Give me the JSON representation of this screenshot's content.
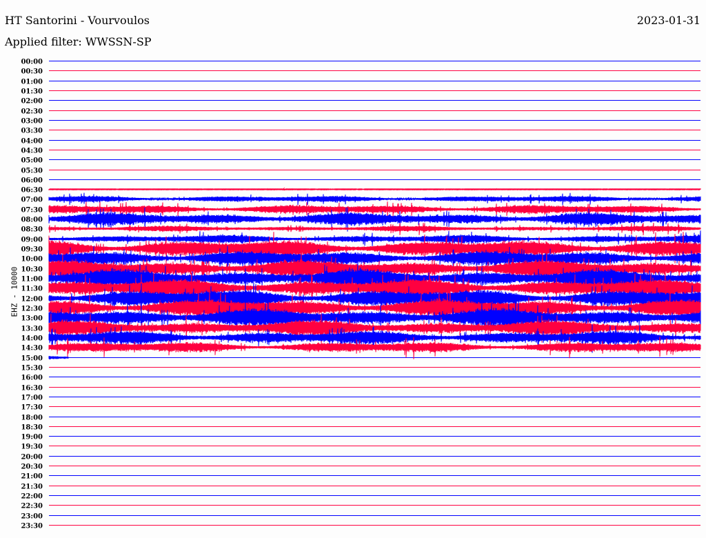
{
  "header": {
    "title": "HT Santorini - Vourvoulos",
    "filter": "Applied filter: WWSSN-SP",
    "date": "2023-01-31"
  },
  "chart_data": {
    "type": "line",
    "title": "HT Santorini - Vourvoulos",
    "subtitle": "Applied filter: WWSSN-SP",
    "ylabel": "EHZ - 10000",
    "xlabel": "",
    "colors": {
      "even": "#0000ff",
      "odd": "#ff0040"
    },
    "rows": [
      {
        "label": "00:00",
        "amplitude": 0
      },
      {
        "label": "00:30",
        "amplitude": 0
      },
      {
        "label": "01:00",
        "amplitude": 0
      },
      {
        "label": "01:30",
        "amplitude": 0
      },
      {
        "label": "02:00",
        "amplitude": 0
      },
      {
        "label": "02:30",
        "amplitude": 0
      },
      {
        "label": "03:00",
        "amplitude": 0
      },
      {
        "label": "03:30",
        "amplitude": 0
      },
      {
        "label": "04:00",
        "amplitude": 0
      },
      {
        "label": "04:30",
        "amplitude": 0
      },
      {
        "label": "05:00",
        "amplitude": 0
      },
      {
        "label": "05:30",
        "amplitude": 0
      },
      {
        "label": "06:00",
        "amplitude": 0
      },
      {
        "label": "06:30",
        "amplitude": 0.05
      },
      {
        "label": "07:00",
        "amplitude": 0.35
      },
      {
        "label": "07:30",
        "amplitude": 0.5
      },
      {
        "label": "08:00",
        "amplitude": 0.7
      },
      {
        "label": "08:30",
        "amplitude": 0.3
      },
      {
        "label": "09:00",
        "amplitude": 0.45
      },
      {
        "label": "09:30",
        "amplitude": 0.95
      },
      {
        "label": "10:00",
        "amplitude": 0.85
      },
      {
        "label": "10:30",
        "amplitude": 0.95
      },
      {
        "label": "11:00",
        "amplitude": 1.0
      },
      {
        "label": "11:30",
        "amplitude": 1.0
      },
      {
        "label": "12:00",
        "amplitude": 1.0
      },
      {
        "label": "12:30",
        "amplitude": 1.0
      },
      {
        "label": "13:00",
        "amplitude": 1.0
      },
      {
        "label": "13:30",
        "amplitude": 0.85
      },
      {
        "label": "14:00",
        "amplitude": 0.75
      },
      {
        "label": "14:30",
        "amplitude": 0.6
      },
      {
        "label": "15:00",
        "amplitude": 0.4,
        "partial": 0.03
      },
      {
        "label": "15:30",
        "amplitude": 0
      },
      {
        "label": "16:00",
        "amplitude": 0
      },
      {
        "label": "16:30",
        "amplitude": 0
      },
      {
        "label": "17:00",
        "amplitude": 0
      },
      {
        "label": "17:30",
        "amplitude": 0
      },
      {
        "label": "18:00",
        "amplitude": 0
      },
      {
        "label": "18:30",
        "amplitude": 0
      },
      {
        "label": "19:00",
        "amplitude": 0
      },
      {
        "label": "19:30",
        "amplitude": 0
      },
      {
        "label": "20:00",
        "amplitude": 0
      },
      {
        "label": "20:30",
        "amplitude": 0
      },
      {
        "label": "21:00",
        "amplitude": 0
      },
      {
        "label": "21:30",
        "amplitude": 0
      },
      {
        "label": "22:00",
        "amplitude": 0
      },
      {
        "label": "22:30",
        "amplitude": 0
      },
      {
        "label": "23:00",
        "amplitude": 0
      },
      {
        "label": "23:30",
        "amplitude": 0
      }
    ]
  }
}
